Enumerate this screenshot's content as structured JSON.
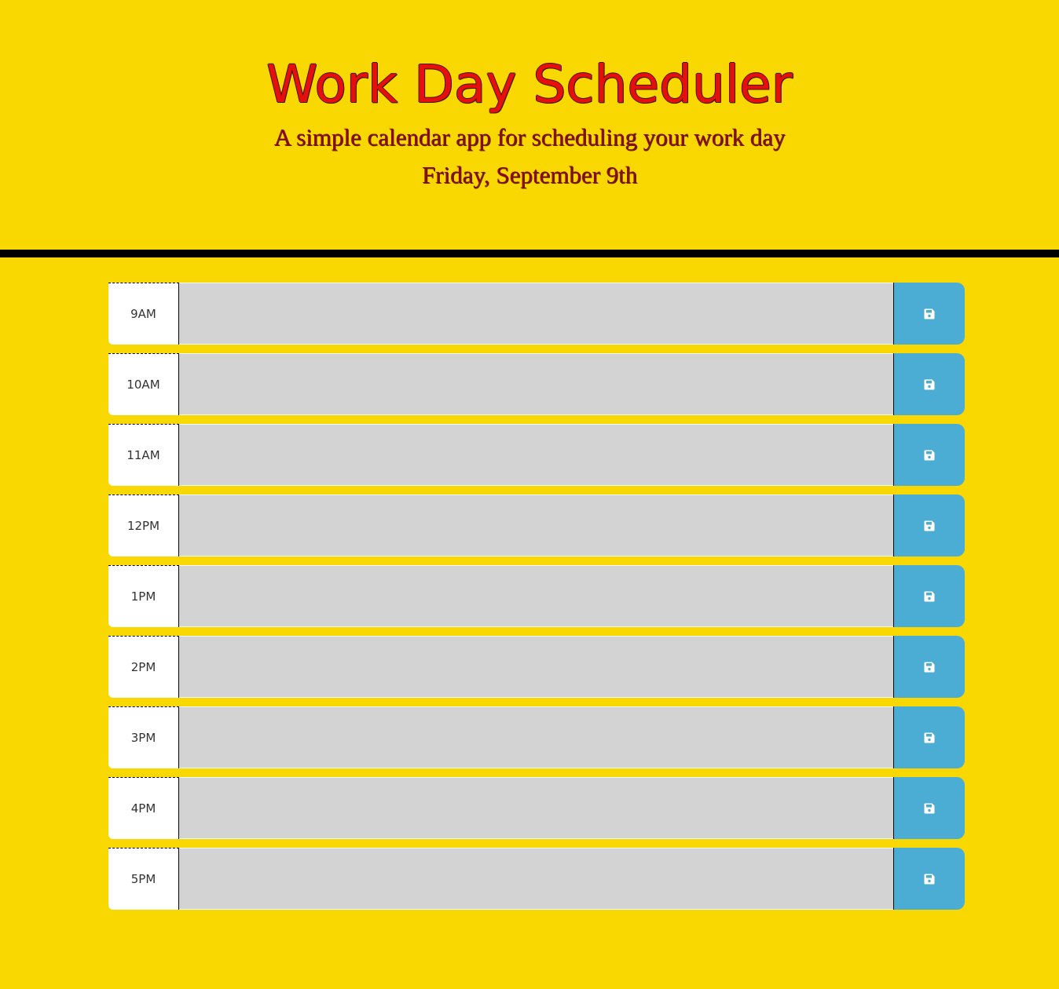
{
  "header": {
    "title": "Work Day Scheduler",
    "lead": "A simple calendar app for scheduling your work day",
    "current_day": "Friday, September 9th"
  },
  "colors": {
    "background": "#f9d801",
    "title": "#e60e0e",
    "subtitle": "#8b0a0a",
    "divider": "#000000",
    "hour_bg": "#ffffff",
    "description_bg": "#d3d3d3",
    "save_button": "#4bacd4"
  },
  "time_blocks": [
    {
      "hour": "9AM",
      "description": "",
      "save_icon": "save-icon"
    },
    {
      "hour": "10AM",
      "description": "",
      "save_icon": "save-icon"
    },
    {
      "hour": "11AM",
      "description": "",
      "save_icon": "save-icon"
    },
    {
      "hour": "12PM",
      "description": "",
      "save_icon": "save-icon"
    },
    {
      "hour": "1PM",
      "description": "",
      "save_icon": "save-icon"
    },
    {
      "hour": "2PM",
      "description": "",
      "save_icon": "save-icon"
    },
    {
      "hour": "3PM",
      "description": "",
      "save_icon": "save-icon"
    },
    {
      "hour": "4PM",
      "description": "",
      "save_icon": "save-icon"
    },
    {
      "hour": "5PM",
      "description": "",
      "save_icon": "save-icon"
    }
  ]
}
